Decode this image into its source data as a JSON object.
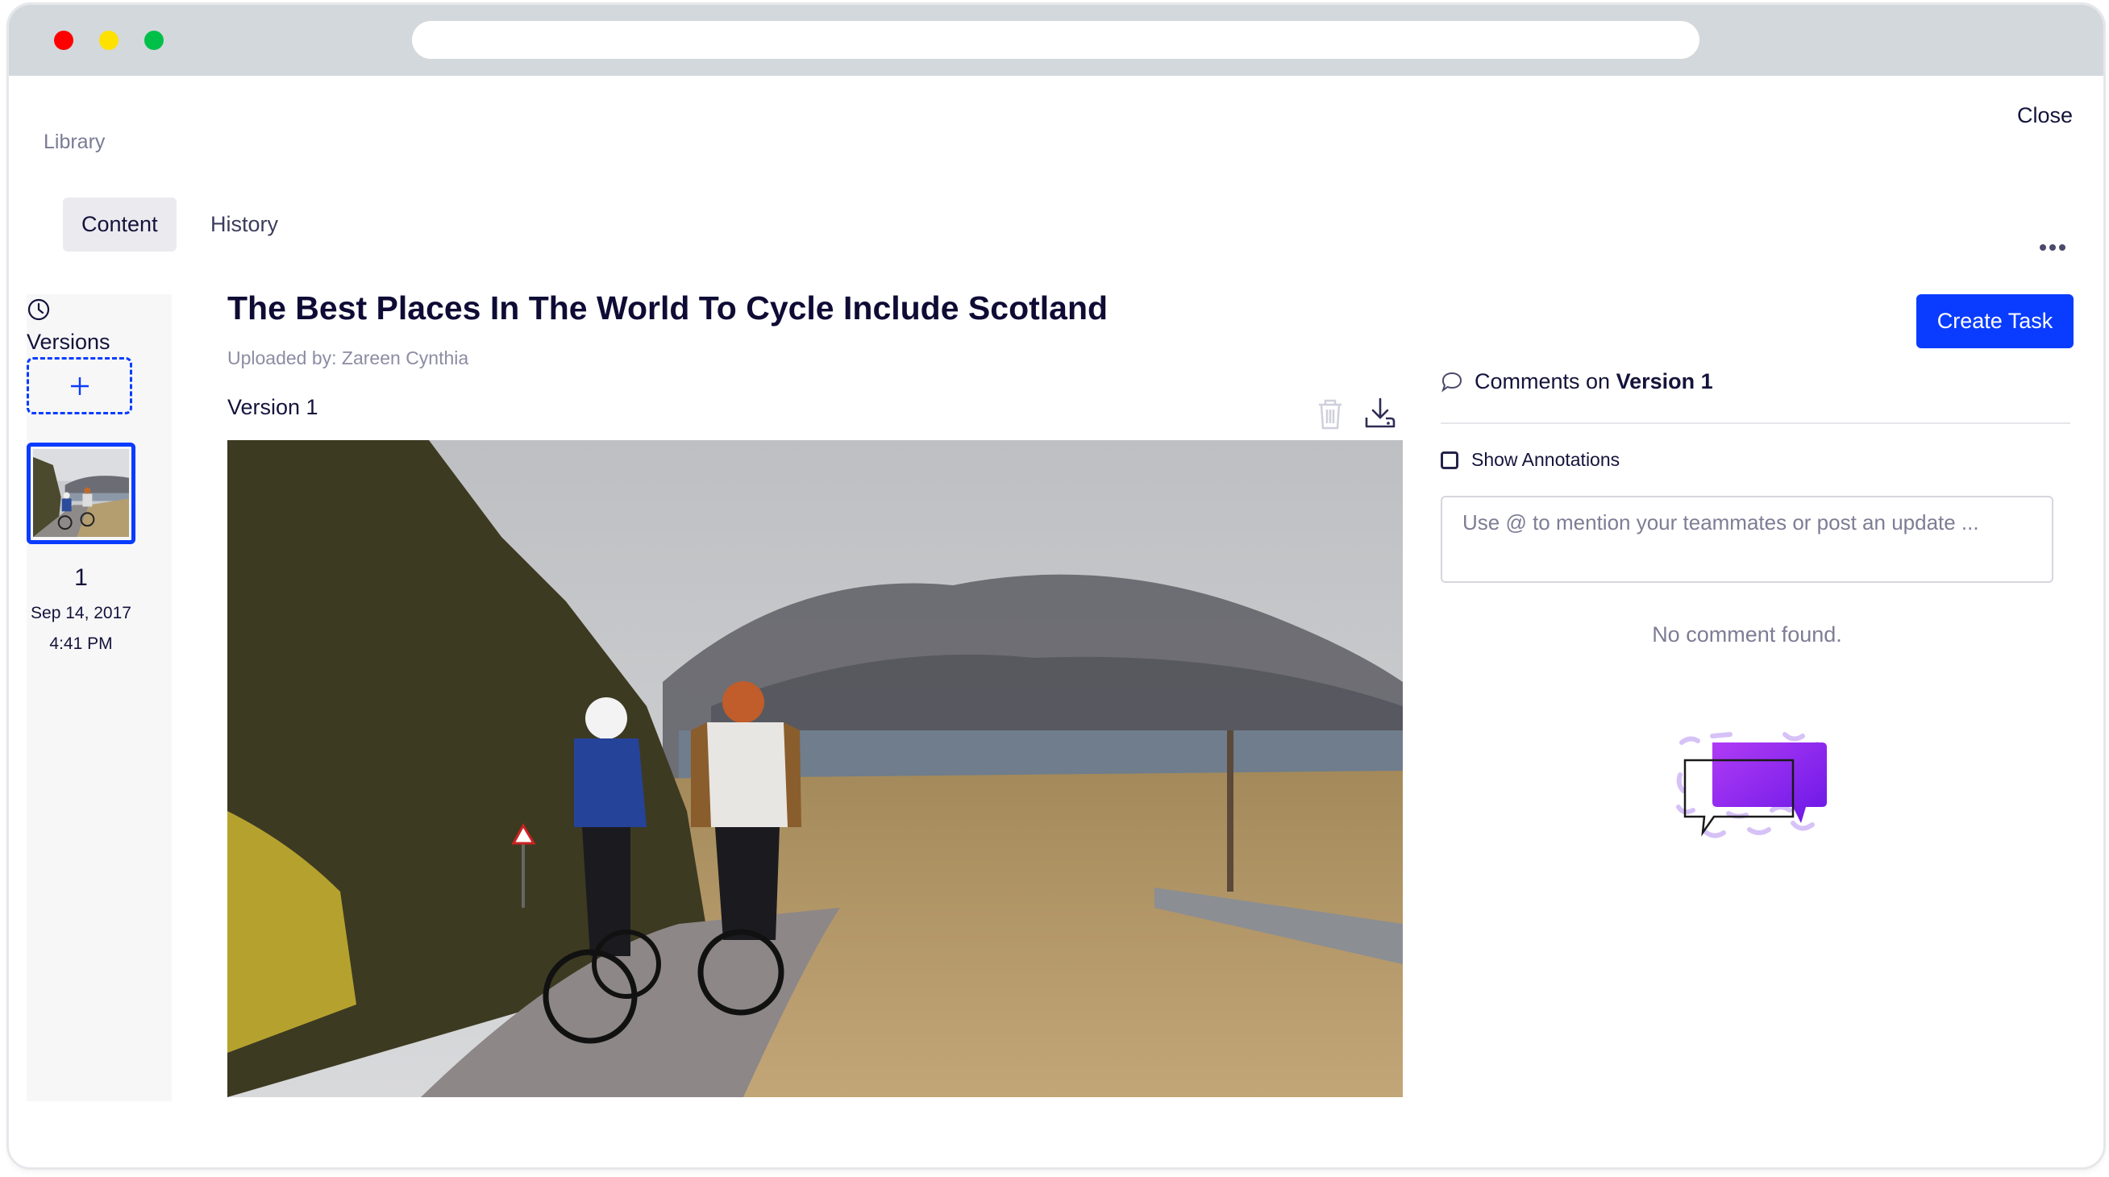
{
  "browser": {
    "traffic_lights": [
      "close",
      "minimize",
      "maximize"
    ],
    "address_bar_value": ""
  },
  "header": {
    "breadcrumb": "Library",
    "close_label": "Close",
    "more_icon": "more-horizontal-icon"
  },
  "tabs": [
    {
      "label": "Content",
      "active": true
    },
    {
      "label": "History",
      "active": false
    }
  ],
  "sidebar": {
    "icon": "clock-icon",
    "title": "Versions",
    "add_icon": "plus-icon",
    "versions": [
      {
        "number": "1",
        "date": "Sep 14, 2017",
        "time": "4:41 PM",
        "selected": true
      }
    ]
  },
  "content": {
    "title": "The Best Places In The World To Cycle Include Scotland",
    "uploaded_by": "Uploaded by: Zareen Cynthia",
    "version_label": "Version 1",
    "actions": [
      {
        "icon": "trash-icon",
        "enabled": false
      },
      {
        "icon": "download-icon",
        "enabled": true
      }
    ],
    "image_alt": "Two cyclists riding up a road in the Scottish Highlands with a loch and misty mountains behind"
  },
  "comments": {
    "create_task_label": "Create Task",
    "heading_prefix": "Comments on ",
    "heading_version": "Version 1",
    "show_annotations_label": "Show Annotations",
    "show_annotations_checked": false,
    "input_placeholder": "Use @ to mention your teammates or post an update ...",
    "input_value": "",
    "empty_message": "No comment found."
  },
  "colors": {
    "accent": "#0a3cff",
    "illustration_purple": "#8a2be2",
    "chrome_bg": "#d3d8dc"
  }
}
